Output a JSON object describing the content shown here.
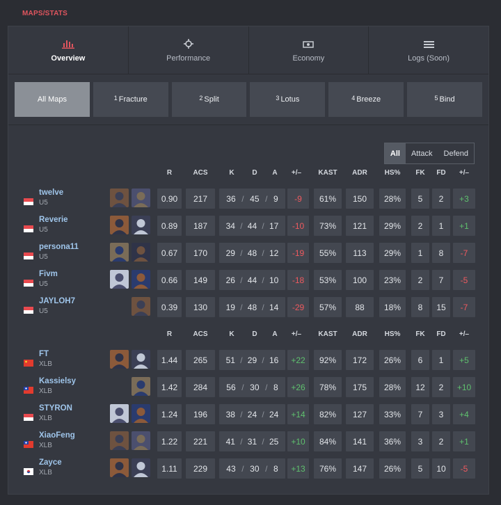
{
  "section_title": "MAPS/STATS",
  "tabs": [
    {
      "label": "Overview",
      "icon": "bar-chart-icon"
    },
    {
      "label": "Performance",
      "icon": "crosshair-icon"
    },
    {
      "label": "Economy",
      "icon": "money-icon"
    },
    {
      "label": "Logs (Soon)",
      "icon": "list-icon"
    }
  ],
  "maps": [
    {
      "num": "",
      "name": "All Maps"
    },
    {
      "num": "1",
      "name": "Fracture"
    },
    {
      "num": "2",
      "name": "Split"
    },
    {
      "num": "3",
      "name": "Lotus"
    },
    {
      "num": "4",
      "name": "Breeze"
    },
    {
      "num": "5",
      "name": "Bind"
    }
  ],
  "side_filter": [
    "All",
    "Attack",
    "Defend"
  ],
  "columns": [
    "R",
    "ACS",
    "K",
    "D",
    "A",
    "+/–",
    "KAST",
    "ADR",
    "HS%",
    "FK",
    "FD",
    "+/–"
  ],
  "kda_sep": "/",
  "teams": [
    {
      "players": [
        {
          "name": "twelve",
          "team": "U5",
          "flag": "sg",
          "agents": [
            "agent-icon",
            "agent-icon"
          ],
          "r": "0.90",
          "acs": "217",
          "k": "36",
          "d": "45",
          "a": "9",
          "kd": "-9",
          "kast": "61%",
          "adr": "150",
          "hs": "28%",
          "fk": "5",
          "fd": "2",
          "fkd": "+3"
        },
        {
          "name": "Reverie",
          "team": "U5",
          "flag": "sg",
          "agents": [
            "agent-icon",
            "agent-icon"
          ],
          "r": "0.89",
          "acs": "187",
          "k": "34",
          "d": "44",
          "a": "17",
          "kd": "-10",
          "kast": "73%",
          "adr": "121",
          "hs": "29%",
          "fk": "2",
          "fd": "1",
          "fkd": "+1"
        },
        {
          "name": "persona11",
          "team": "U5",
          "flag": "sg",
          "agents": [
            "agent-icon",
            "agent-icon"
          ],
          "r": "0.67",
          "acs": "170",
          "k": "29",
          "d": "48",
          "a": "12",
          "kd": "-19",
          "kast": "55%",
          "adr": "113",
          "hs": "29%",
          "fk": "1",
          "fd": "8",
          "fkd": "-7"
        },
        {
          "name": "Fivm",
          "team": "U5",
          "flag": "sg",
          "agents": [
            "agent-icon",
            "agent-icon"
          ],
          "r": "0.66",
          "acs": "149",
          "k": "26",
          "d": "44",
          "a": "10",
          "kd": "-18",
          "kast": "53%",
          "adr": "100",
          "hs": "23%",
          "fk": "2",
          "fd": "7",
          "fkd": "-5"
        },
        {
          "name": "JAYLOH7",
          "team": "U5",
          "flag": "sg",
          "agents": [
            "agent-icon"
          ],
          "r": "0.39",
          "acs": "130",
          "k": "19",
          "d": "48",
          "a": "14",
          "kd": "-29",
          "kast": "57%",
          "adr": "88",
          "hs": "18%",
          "fk": "8",
          "fd": "15",
          "fkd": "-7"
        }
      ]
    },
    {
      "players": [
        {
          "name": "FT",
          "team": "XLB",
          "flag": "cn",
          "agents": [
            "agent-icon",
            "agent-icon"
          ],
          "r": "1.44",
          "acs": "265",
          "k": "51",
          "d": "29",
          "a": "16",
          "kd": "+22",
          "kast": "92%",
          "adr": "172",
          "hs": "26%",
          "fk": "6",
          "fd": "1",
          "fkd": "+5"
        },
        {
          "name": "Kassielsy",
          "team": "XLB",
          "flag": "tw",
          "agents": [
            "agent-icon"
          ],
          "r": "1.42",
          "acs": "284",
          "k": "56",
          "d": "30",
          "a": "8",
          "kd": "+26",
          "kast": "78%",
          "adr": "175",
          "hs": "28%",
          "fk": "12",
          "fd": "2",
          "fkd": "+10"
        },
        {
          "name": "STYRON",
          "team": "XLB",
          "flag": "sg",
          "agents": [
            "agent-icon",
            "agent-icon"
          ],
          "r": "1.24",
          "acs": "196",
          "k": "38",
          "d": "24",
          "a": "24",
          "kd": "+14",
          "kast": "82%",
          "adr": "127",
          "hs": "33%",
          "fk": "7",
          "fd": "3",
          "fkd": "+4"
        },
        {
          "name": "XiaoFeng",
          "team": "XLB",
          "flag": "tw",
          "agents": [
            "agent-icon",
            "agent-icon"
          ],
          "r": "1.22",
          "acs": "221",
          "k": "41",
          "d": "31",
          "a": "25",
          "kd": "+10",
          "kast": "84%",
          "adr": "141",
          "hs": "36%",
          "fk": "3",
          "fd": "2",
          "fkd": "+1"
        },
        {
          "name": "Zayce",
          "team": "XLB",
          "flag": "kr",
          "agents": [
            "agent-icon",
            "agent-icon"
          ],
          "r": "1.11",
          "acs": "229",
          "k": "43",
          "d": "30",
          "a": "8",
          "kd": "+13",
          "kast": "76%",
          "adr": "147",
          "hs": "26%",
          "fk": "5",
          "fd": "10",
          "fkd": "-5"
        }
      ]
    }
  ]
}
